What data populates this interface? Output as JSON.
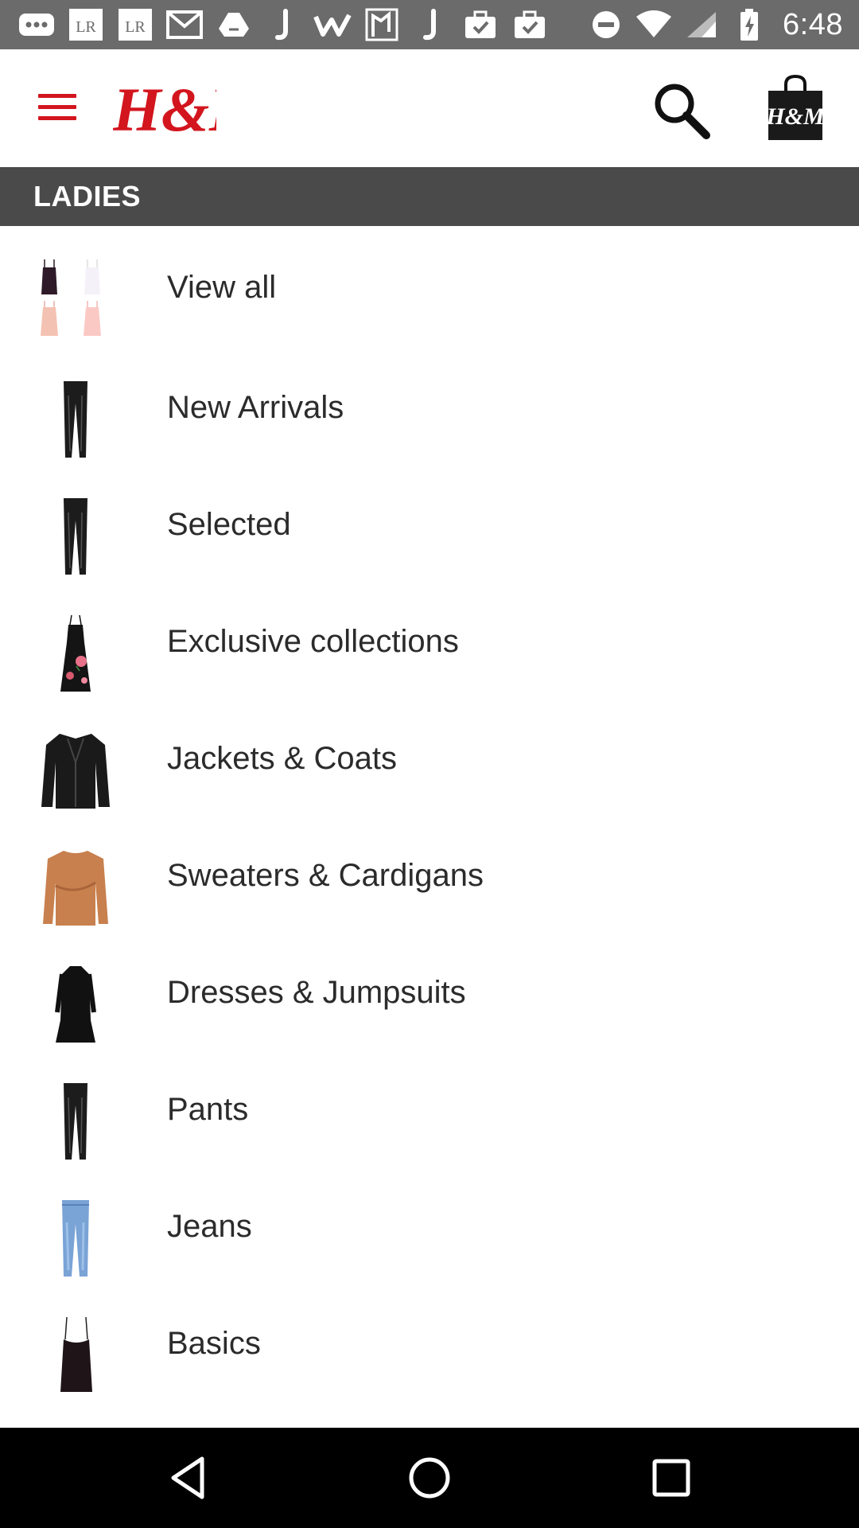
{
  "status_bar": {
    "time": "6:48",
    "left_icons": [
      "more-dots-icon",
      "lightroom-icon",
      "lightroom-icon",
      "gmail-icon",
      "drive-icon",
      "j-app-icon",
      "w-app-icon",
      "map-app-icon",
      "j-app-icon",
      "briefcase-check-icon",
      "briefcase-check-icon"
    ],
    "right_icons": [
      "do-not-disturb-icon",
      "wifi-icon",
      "signal-icon",
      "battery-charging-icon"
    ]
  },
  "header": {
    "logo_text": "H&M",
    "brand_color": "#d3151e",
    "menu_icon": "hamburger-menu-icon",
    "search_icon": "search-icon",
    "bag_icon": "shopping-bag-icon",
    "bag_logo_text": "H&M"
  },
  "section": {
    "title": "LADIES"
  },
  "categories": [
    {
      "label": "View all",
      "thumbnail": "camisoles-grid"
    },
    {
      "label": "New Arrivals",
      "thumbnail": "leather-leggings"
    },
    {
      "label": "Selected",
      "thumbnail": "leather-leggings"
    },
    {
      "label": "Exclusive collections",
      "thumbnail": "floral-dress"
    },
    {
      "label": "Jackets & Coats",
      "thumbnail": "leather-jacket"
    },
    {
      "label": "Sweaters & Cardigans",
      "thumbnail": "orange-sweater"
    },
    {
      "label": "Dresses & Jumpsuits",
      "thumbnail": "black-dress"
    },
    {
      "label": "Pants",
      "thumbnail": "leather-leggings"
    },
    {
      "label": "Jeans",
      "thumbnail": "blue-jeans"
    },
    {
      "label": "Basics",
      "thumbnail": "black-camisole"
    }
  ],
  "nav_bar": {
    "back_icon": "back-triangle-icon",
    "home_icon": "home-circle-icon",
    "recents_icon": "recents-square-icon"
  }
}
